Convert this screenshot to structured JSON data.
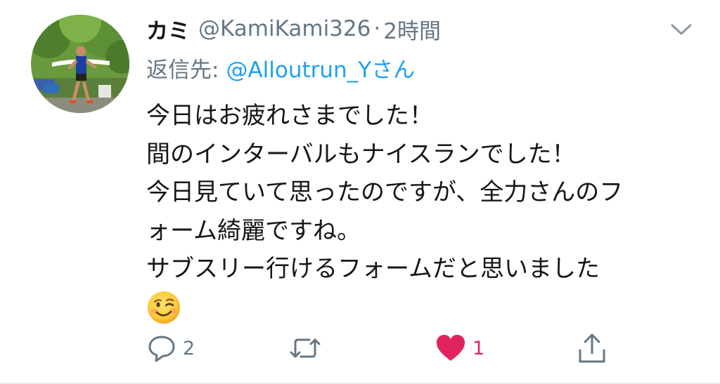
{
  "tweet": {
    "display_name": "カミ",
    "handle": "@KamiKami326",
    "separator": "·",
    "time": "2時間",
    "reply_prefix": "返信先:",
    "reply_target": "@Alloutrun_Yさん",
    "body_lines": [
      "今日はお疲れさまでした！",
      "間のインターバルもナイスランでした！",
      "今日見ていて思ったのですが、全力さんのフ",
      "ォーム綺麗ですね。",
      "サブスリー行けるフォームだと思いました"
    ],
    "emoji": "winking-face"
  },
  "actions": {
    "reply_count": "2",
    "retweet_count": "",
    "like_count": "1",
    "liked": true
  },
  "colors": {
    "accent": "#1da1f2",
    "secondary_text": "#657786",
    "like": "#e0245e",
    "text": "#14171a"
  }
}
